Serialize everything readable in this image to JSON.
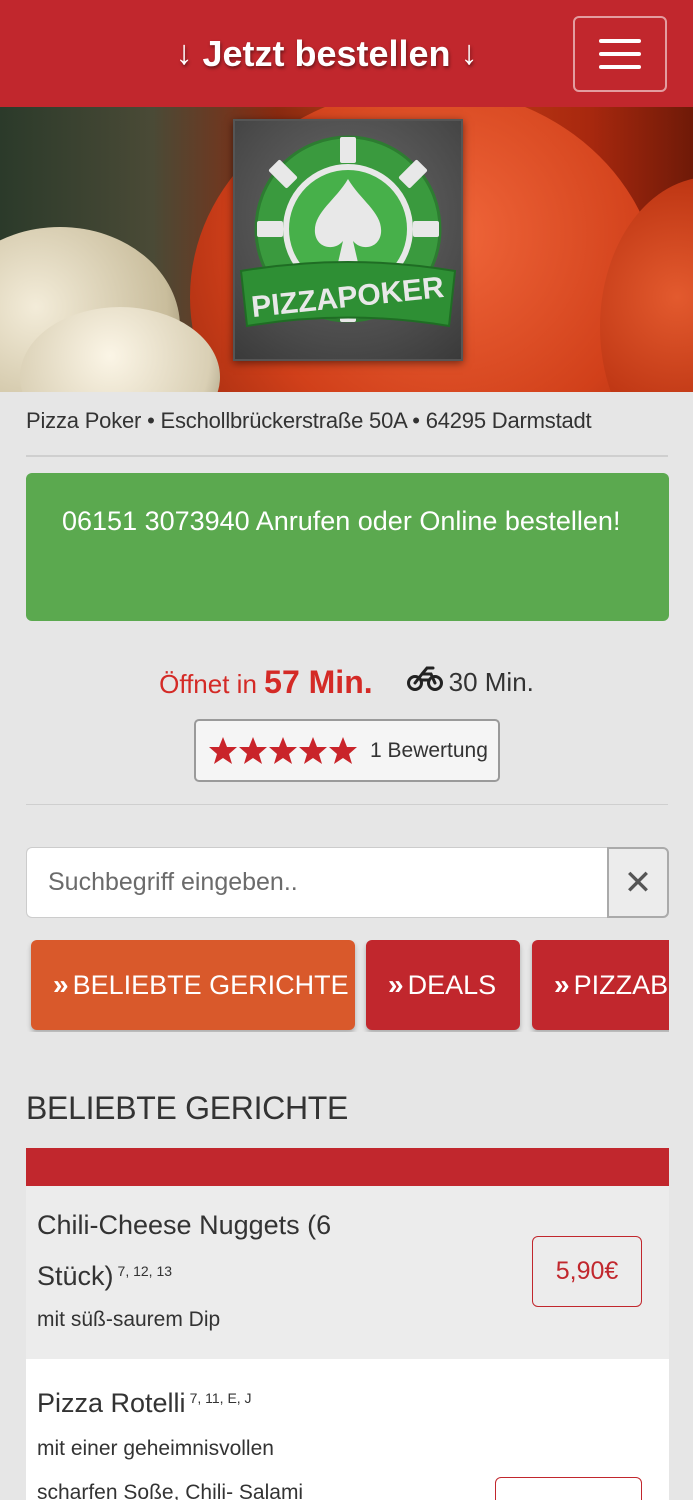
{
  "header": {
    "order_label": "Jetzt bestellen",
    "menu_icon": "hamburger-menu-icon"
  },
  "hero": {
    "logo_text": "PIZZAPOKER",
    "colors": {
      "logo_green": "#3a9a3e",
      "bar_red": "#c1272d"
    }
  },
  "info": {
    "address": "Pizza Poker • Eschollbrückerstraße 50A • 64295 Darmstadt",
    "call_text": "06151 3073940 Anrufen oder Online bestellen!",
    "opens_label": "Öffnet in",
    "opens_value": "57 Min.",
    "delivery_time": "30 Min.",
    "rating_stars": 5,
    "rating_count": "1 Bewertung"
  },
  "search": {
    "placeholder": "Suchbegriff eingeben..",
    "clear_icon": "close-icon"
  },
  "categories": [
    {
      "label": "BELIEBTE GERICHTE"
    },
    {
      "label": "DEALS"
    },
    {
      "label": "PIZZABRÖTCHEN"
    }
  ],
  "section": {
    "title": "BELIEBTE GERICHTE"
  },
  "items": [
    {
      "name": "Chili-Cheese Nuggets (6 Stück)",
      "allergens": "7, 12, 13",
      "description": "mit süß-saurem Dip",
      "price": "5,90€"
    },
    {
      "name": "Pizza Rotelli",
      "allergens": "7, 11, E, J",
      "description": "mit einer geheimnisvollen scharfen Soße, Chili- Salami",
      "price": ""
    }
  ]
}
